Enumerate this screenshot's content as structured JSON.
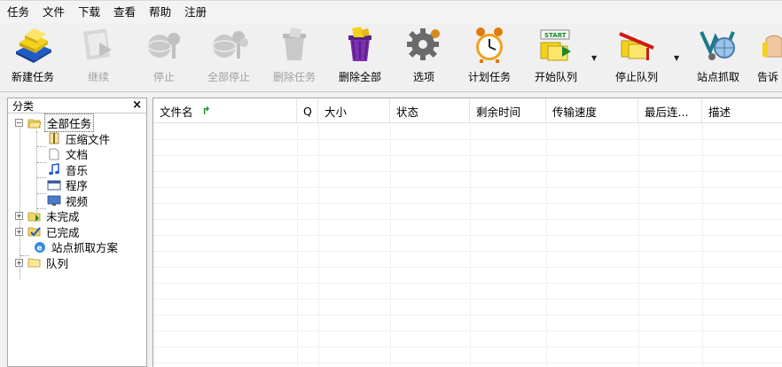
{
  "menu": [
    "任务",
    "文件",
    "下载",
    "查看",
    "帮助",
    "注册"
  ],
  "toolbar": {
    "new_task": "新建任务",
    "resume": "继续",
    "stop": "停止",
    "stop_all": "全部停止",
    "delete_task": "删除任务",
    "delete_all": "删除全部",
    "options": "选项",
    "scheduler": "计划任务",
    "start_queue": "开始队列",
    "start_badge": "START",
    "stop_queue": "停止队列",
    "site_grabber": "站点抓取",
    "tell_friend": "告诉"
  },
  "sidebar": {
    "title": "分类",
    "close": "×",
    "all_tasks": "全部任务",
    "compressed": "压缩文件",
    "documents": "文档",
    "music": "音乐",
    "programs": "程序",
    "video": "视频",
    "unfinished": "未完成",
    "finished": "已完成",
    "grabber_projects": "站点抓取方案",
    "queues": "队列"
  },
  "columns": {
    "filename": "文件名",
    "sort_glyph": "↱",
    "q": "Q",
    "size": "大小",
    "status": "状态",
    "time_left": "剩余时间",
    "speed": "传输速度",
    "last_try": "最后连...",
    "description": "描述"
  },
  "colors": {
    "accent_yellow": "#f5d21a",
    "accent_blue": "#1f5bc7",
    "accent_purple": "#7c2fb0",
    "check_green": "#1a8a2c",
    "stop_red": "#d01818"
  }
}
